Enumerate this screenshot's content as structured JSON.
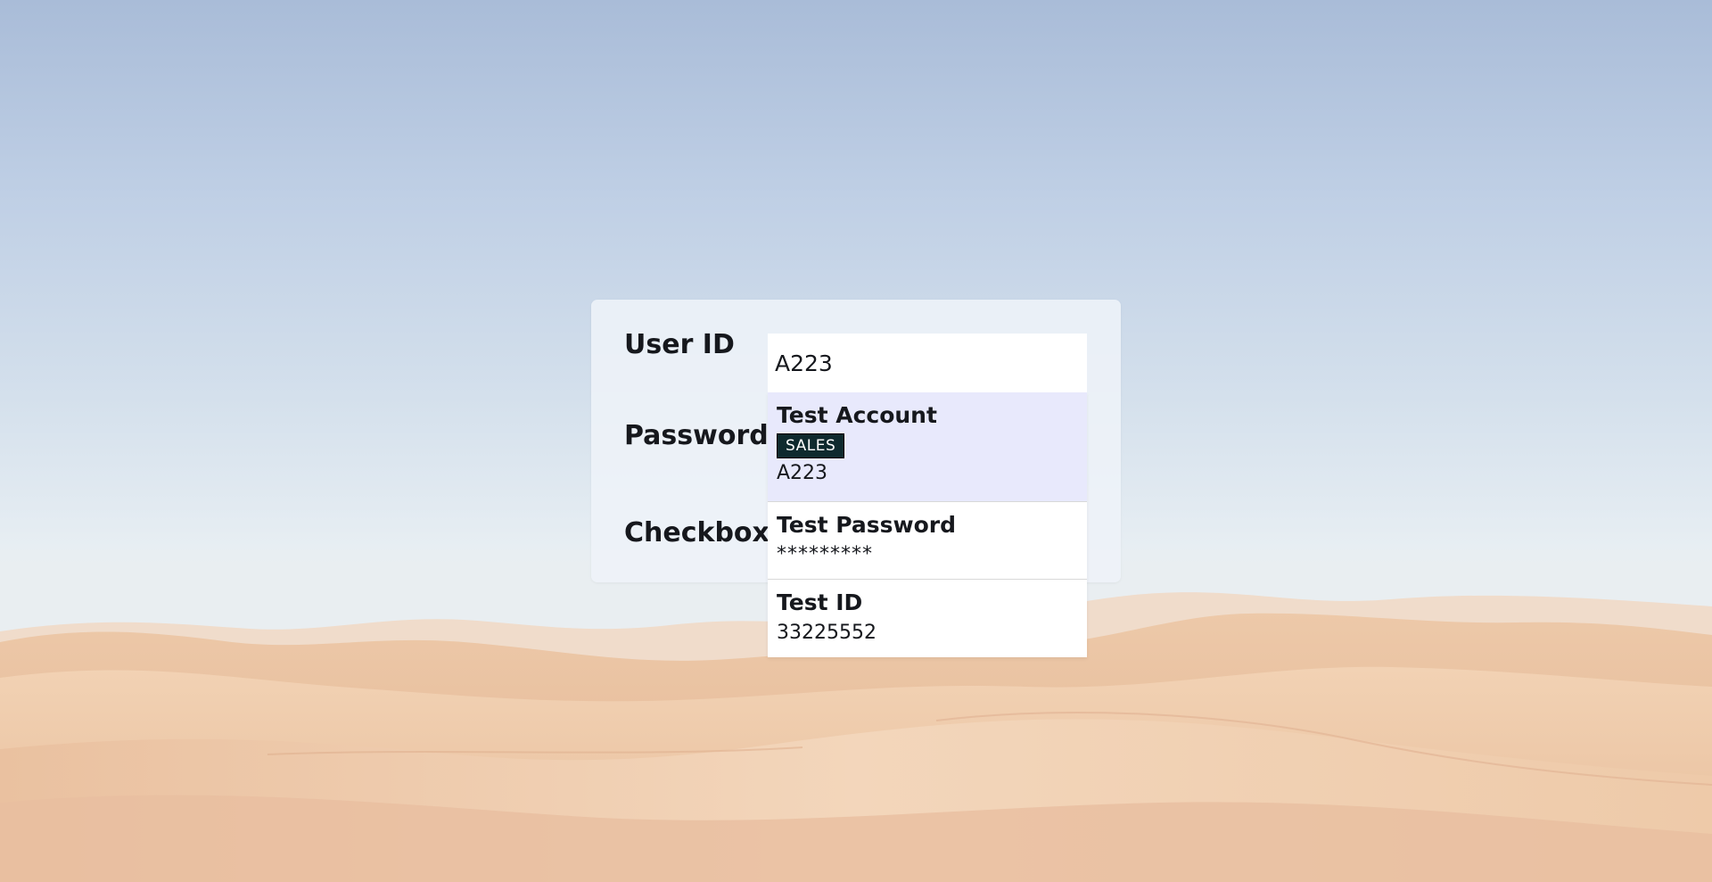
{
  "form": {
    "labels": {
      "user_id": "User ID",
      "password": "Password",
      "checkbox": "Checkbox"
    },
    "user_id_value": "A223"
  },
  "autocomplete": {
    "options": [
      {
        "title": "Test Account",
        "tag": "SALES",
        "value": "A223",
        "highlighted": true
      },
      {
        "title": "Test Password",
        "value": "*********"
      },
      {
        "title": "Test ID",
        "value": "33225552"
      }
    ]
  },
  "colors": {
    "panel": "#eef3f8",
    "highlight": "#e8e9fc",
    "tag_background": "#0f2a2e",
    "text": "#16181d"
  }
}
